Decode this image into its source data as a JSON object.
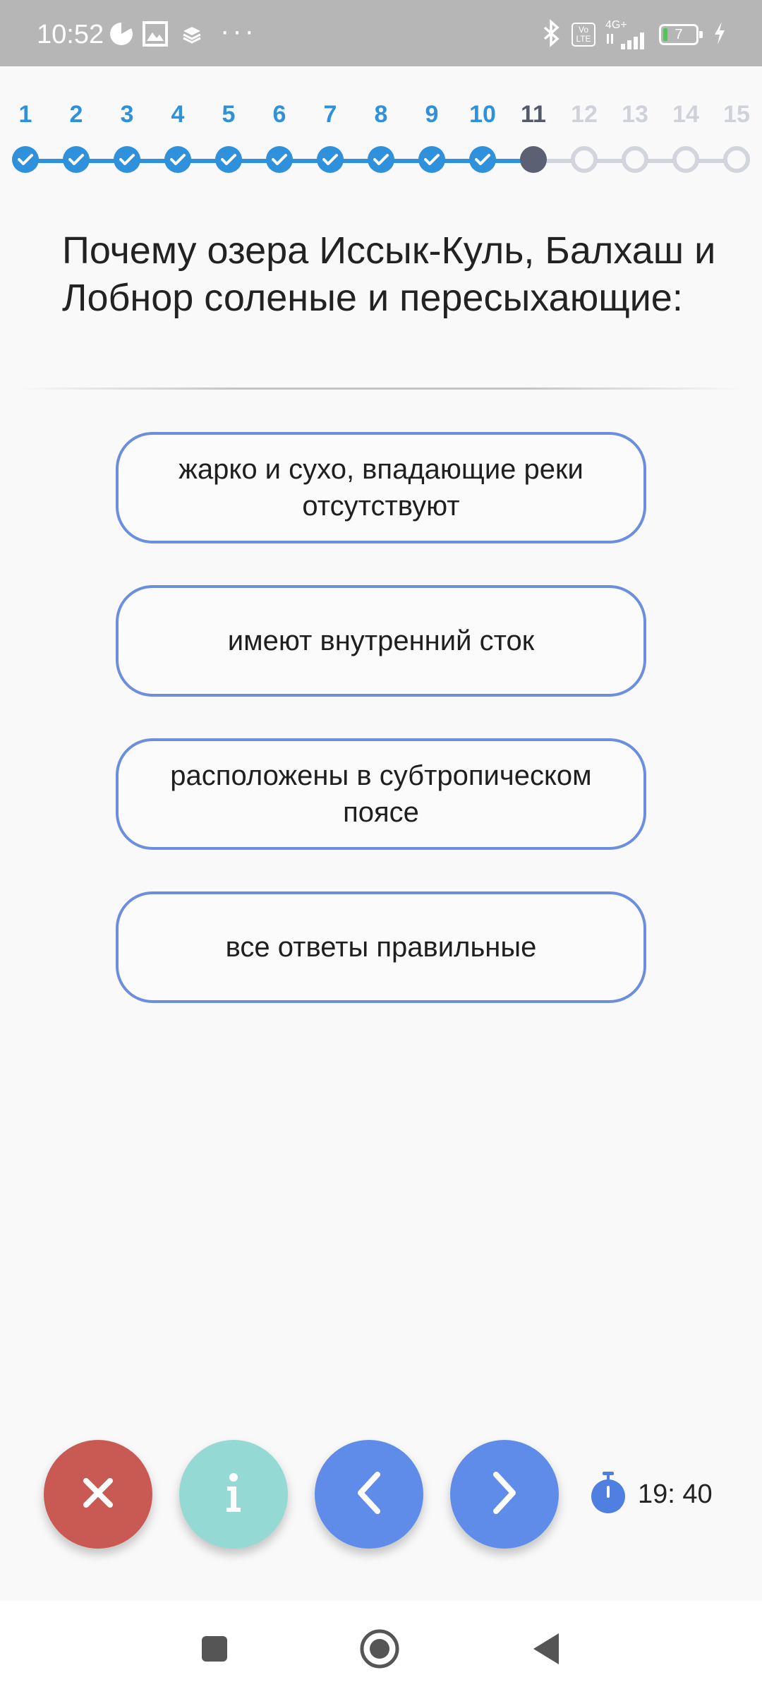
{
  "status_bar": {
    "time": "10:52",
    "overflow": "···",
    "lte_label": "Vo LTE",
    "network": "4G+",
    "battery": "7",
    "icons": [
      "pie-chart-icon",
      "image-icon",
      "layers-icon",
      "bluetooth-icon",
      "signal-icon",
      "charging-icon"
    ]
  },
  "stepper": {
    "current": 11,
    "total": 15,
    "steps": [
      {
        "label": "1",
        "state": "done"
      },
      {
        "label": "2",
        "state": "done"
      },
      {
        "label": "3",
        "state": "done"
      },
      {
        "label": "4",
        "state": "done"
      },
      {
        "label": "5",
        "state": "done"
      },
      {
        "label": "6",
        "state": "done"
      },
      {
        "label": "7",
        "state": "done"
      },
      {
        "label": "8",
        "state": "done"
      },
      {
        "label": "9",
        "state": "done"
      },
      {
        "label": "10",
        "state": "done"
      },
      {
        "label": "11",
        "state": "current"
      },
      {
        "label": "12",
        "state": "todo"
      },
      {
        "label": "13",
        "state": "todo"
      },
      {
        "label": "14",
        "state": "todo"
      },
      {
        "label": "15",
        "state": "todo"
      }
    ]
  },
  "question": {
    "text": "Почему озера Иссык-Куль, Балхаш и Лобнор соленые и пересыхающие:"
  },
  "answers": [
    {
      "text": "жарко и сухо, впадающие реки отсутствуют"
    },
    {
      "text": "имеют внутренний сток"
    },
    {
      "text": "расположены в субтропическом поясе"
    },
    {
      "text": "все ответы правильные"
    }
  ],
  "controls": {
    "close_icon": "close-icon",
    "info_icon": "info-icon",
    "prev_icon": "chevron-left-icon",
    "next_icon": "chevron-right-icon"
  },
  "timer": {
    "text": "19: 40",
    "icon": "stopwatch-icon"
  },
  "navbar": {
    "icons": [
      "recents-square-icon",
      "home-circle-icon",
      "back-triangle-icon"
    ]
  },
  "colors": {
    "done": "#2f90dc",
    "current": "#5b6073",
    "todo": "#d3d5dc",
    "answer_border": "#6b8fde",
    "close": "#c95953",
    "info": "#95d9d5",
    "nav": "#5e8ce8",
    "timer_icon": "#4f7fe0"
  }
}
